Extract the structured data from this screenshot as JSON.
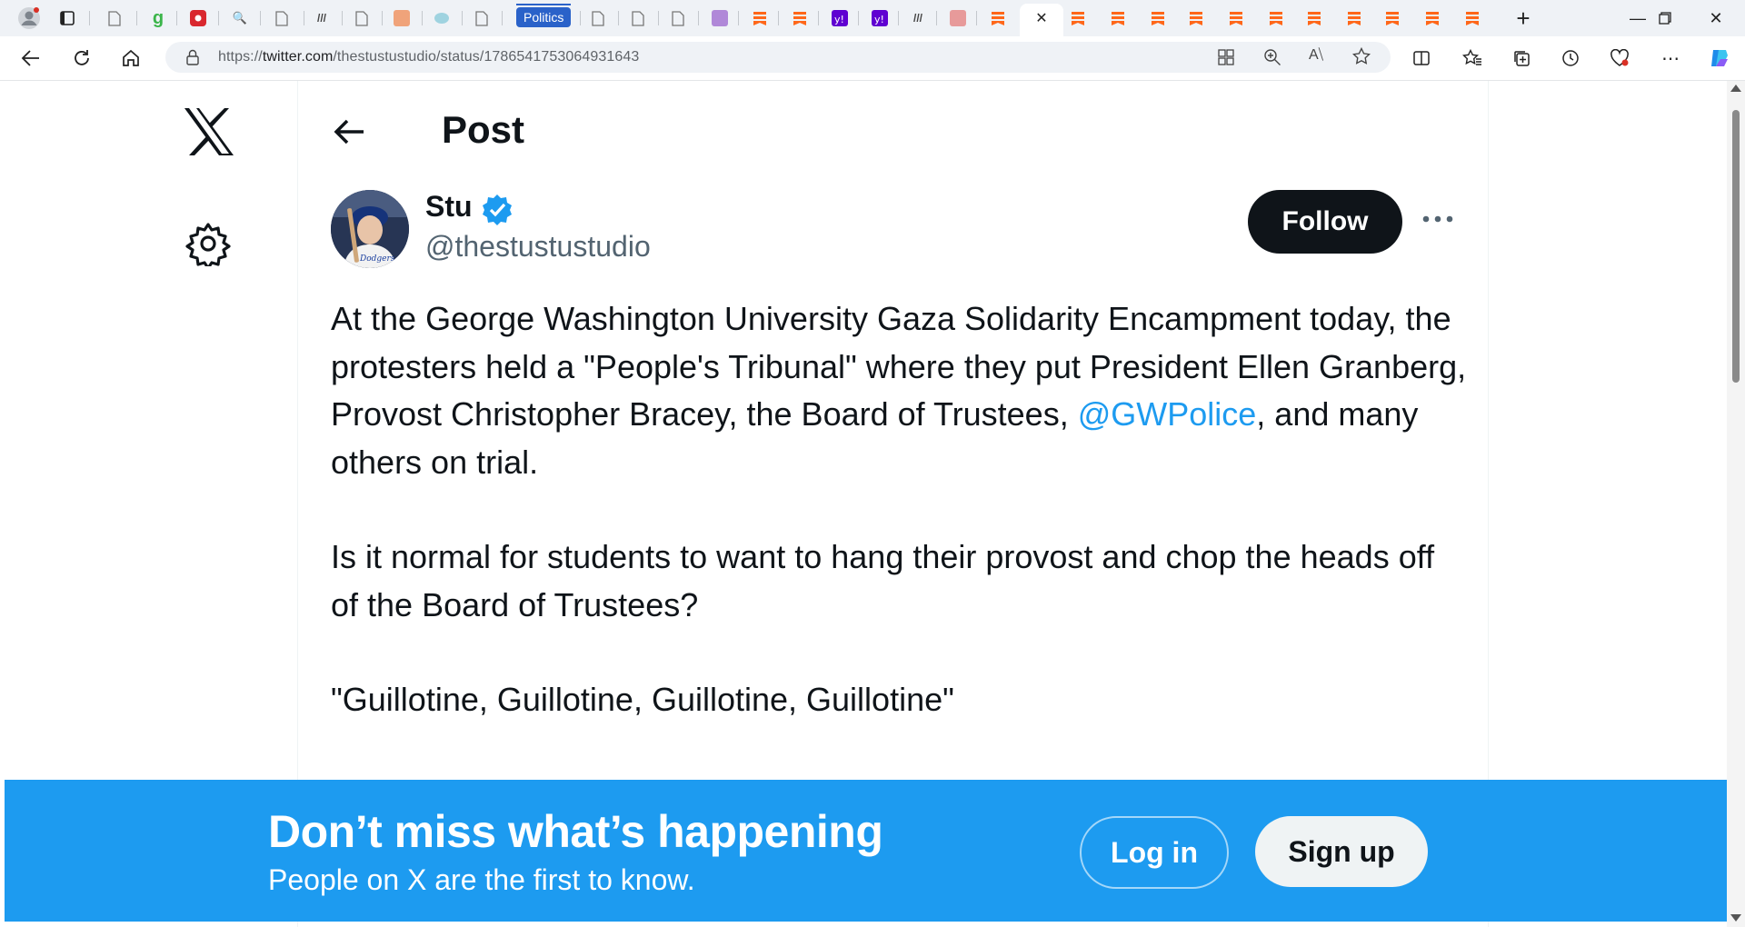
{
  "browser": {
    "tab_label": "Politics",
    "url_prefix": "https://",
    "url_host": "twitter.com",
    "url_path": "/thestustustudio/status/1786541753064931643",
    "accent": "#2a62c9"
  },
  "sidebar": {
    "logo_icon": "x-logo-icon",
    "settings_icon": "gear-icon"
  },
  "header": {
    "title": "Post"
  },
  "tweet": {
    "author_name": "Stu",
    "handle": "@thestustustudio",
    "follow_label": "Follow",
    "paragraph1_before": "At the George Washington University Gaza Solidarity Encampment today, the protesters held a \"People's Tribunal\" where they put President Ellen Granberg, Provost Christopher Bracey, the Board of Trustees, ",
    "mention": "@GWPolice",
    "paragraph1_after": ", and many others on trial.",
    "paragraph2": "Is it normal for students to want to hang their provost and chop the heads off of the Board of Trustees?",
    "paragraph3": "\"Guillotine, Guillotine, Guillotine, Guillotine\""
  },
  "banner": {
    "title": "Don’t miss what’s happening",
    "subtitle": "People on X are the first to know.",
    "login_label": "Log in",
    "signup_label": "Sign up",
    "color": "#1d9bf0"
  }
}
